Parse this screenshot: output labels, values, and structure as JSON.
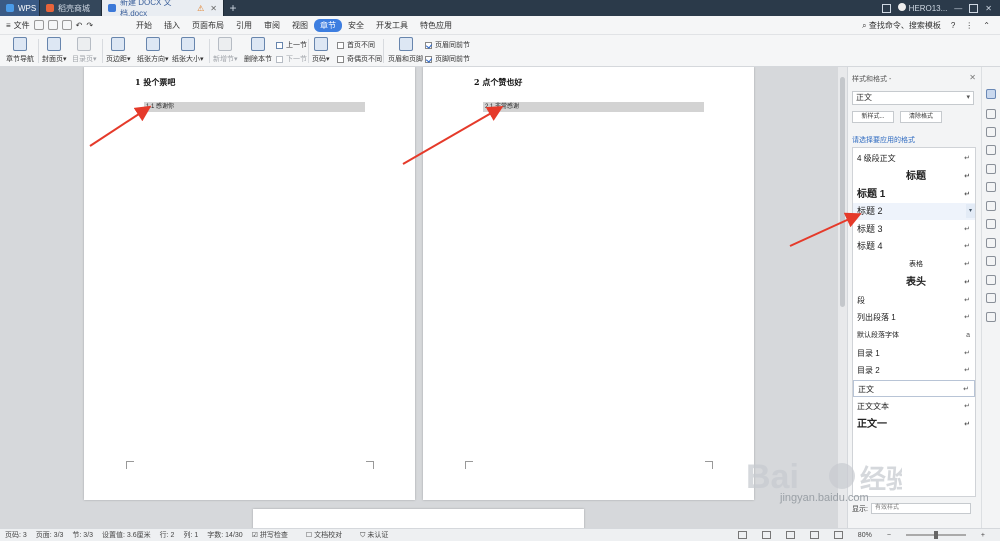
{
  "titlebar": {
    "tabs": [
      {
        "label": "WPS",
        "icon": "wps-logo-icon"
      },
      {
        "label": "稻壳商城",
        "icon": "docer-icon"
      },
      {
        "label": "新建 DOCX 文档.docx",
        "icon": "word-doc-icon"
      }
    ],
    "user": "HERO13...",
    "new_tab": "+"
  },
  "menubar": {
    "file_label": "文件",
    "items": [
      "开始",
      "插入",
      "页面布局",
      "引用",
      "审阅",
      "视图",
      "章节",
      "安全",
      "开发工具",
      "特色应用"
    ],
    "active_index": 6,
    "search_label": "查找命令、搜索模板"
  },
  "ribbon": {
    "chapter_nav": "章节导航",
    "cover_page": "封面页",
    "toc_page": "目录页",
    "margins": "页边距",
    "orientation": "纸张方向",
    "paper_size": "纸张大小",
    "add_section": "新增节",
    "delete_section": "删除本节",
    "prev_section": "上一节",
    "next_section": "下一节",
    "page_number": "页码",
    "first_page_diff": "首页不同",
    "odd_even_diff": "奇偶页不同",
    "header_footer": "页眉和页脚",
    "header_same_prev": "页眉同前节",
    "footer_same_prev": "页脚同前节"
  },
  "document": {
    "page1_heading": "1 投个票吧",
    "page1_sub": "1.1 感谢你",
    "page2_heading": "2 点个赞也好",
    "page2_sub": "2.1 非常感谢"
  },
  "panel": {
    "title": "样式和格式 -",
    "current_style": "正文",
    "new_style": "新样式...",
    "clear_format": "清除格式",
    "select_hint": "请选择要应用的格式",
    "styles": [
      {
        "label": "4 级段正文",
        "mark": "↵"
      },
      {
        "label": "标题",
        "mark": "↵"
      },
      {
        "label": "标题 1",
        "mark": "↵"
      },
      {
        "label": "标题 2",
        "mark": "▾"
      },
      {
        "label": "标题 3",
        "mark": "↵"
      },
      {
        "label": "标题 4",
        "mark": "↵"
      },
      {
        "label": "表格",
        "mark": "↵"
      },
      {
        "label": "表头",
        "mark": "↵"
      },
      {
        "label": "段",
        "mark": "↵"
      },
      {
        "label": "列出段落 1",
        "mark": "↵"
      },
      {
        "label": "默认段落字体",
        "mark": "a"
      },
      {
        "label": "目录 1",
        "mark": "↵"
      },
      {
        "label": "目录 2",
        "mark": "↵"
      },
      {
        "label": "正文",
        "mark": "↵"
      },
      {
        "label": "正文文本",
        "mark": "↵"
      },
      {
        "label": "正文一",
        "mark": "↵"
      }
    ],
    "show_label": "显示:",
    "show_value": "有效样式"
  },
  "statusbar": {
    "page_no": "页码: 3",
    "pages": "页面: 3/3",
    "section": "节: 3/3",
    "position": "设置值: 3.6厘米",
    "row": "行: 2",
    "col": "列: 1",
    "words": "字数: 14/30",
    "spell": "拼写检查",
    "proof": "文档校对",
    "auth": "未认证",
    "zoom": "80%"
  },
  "watermark": {
    "text": "jingyan.baidu.com"
  },
  "colors": {
    "accent": "#3d7ee0",
    "arrow": "#e53a2a",
    "titlebar": "#2b3a4a"
  }
}
